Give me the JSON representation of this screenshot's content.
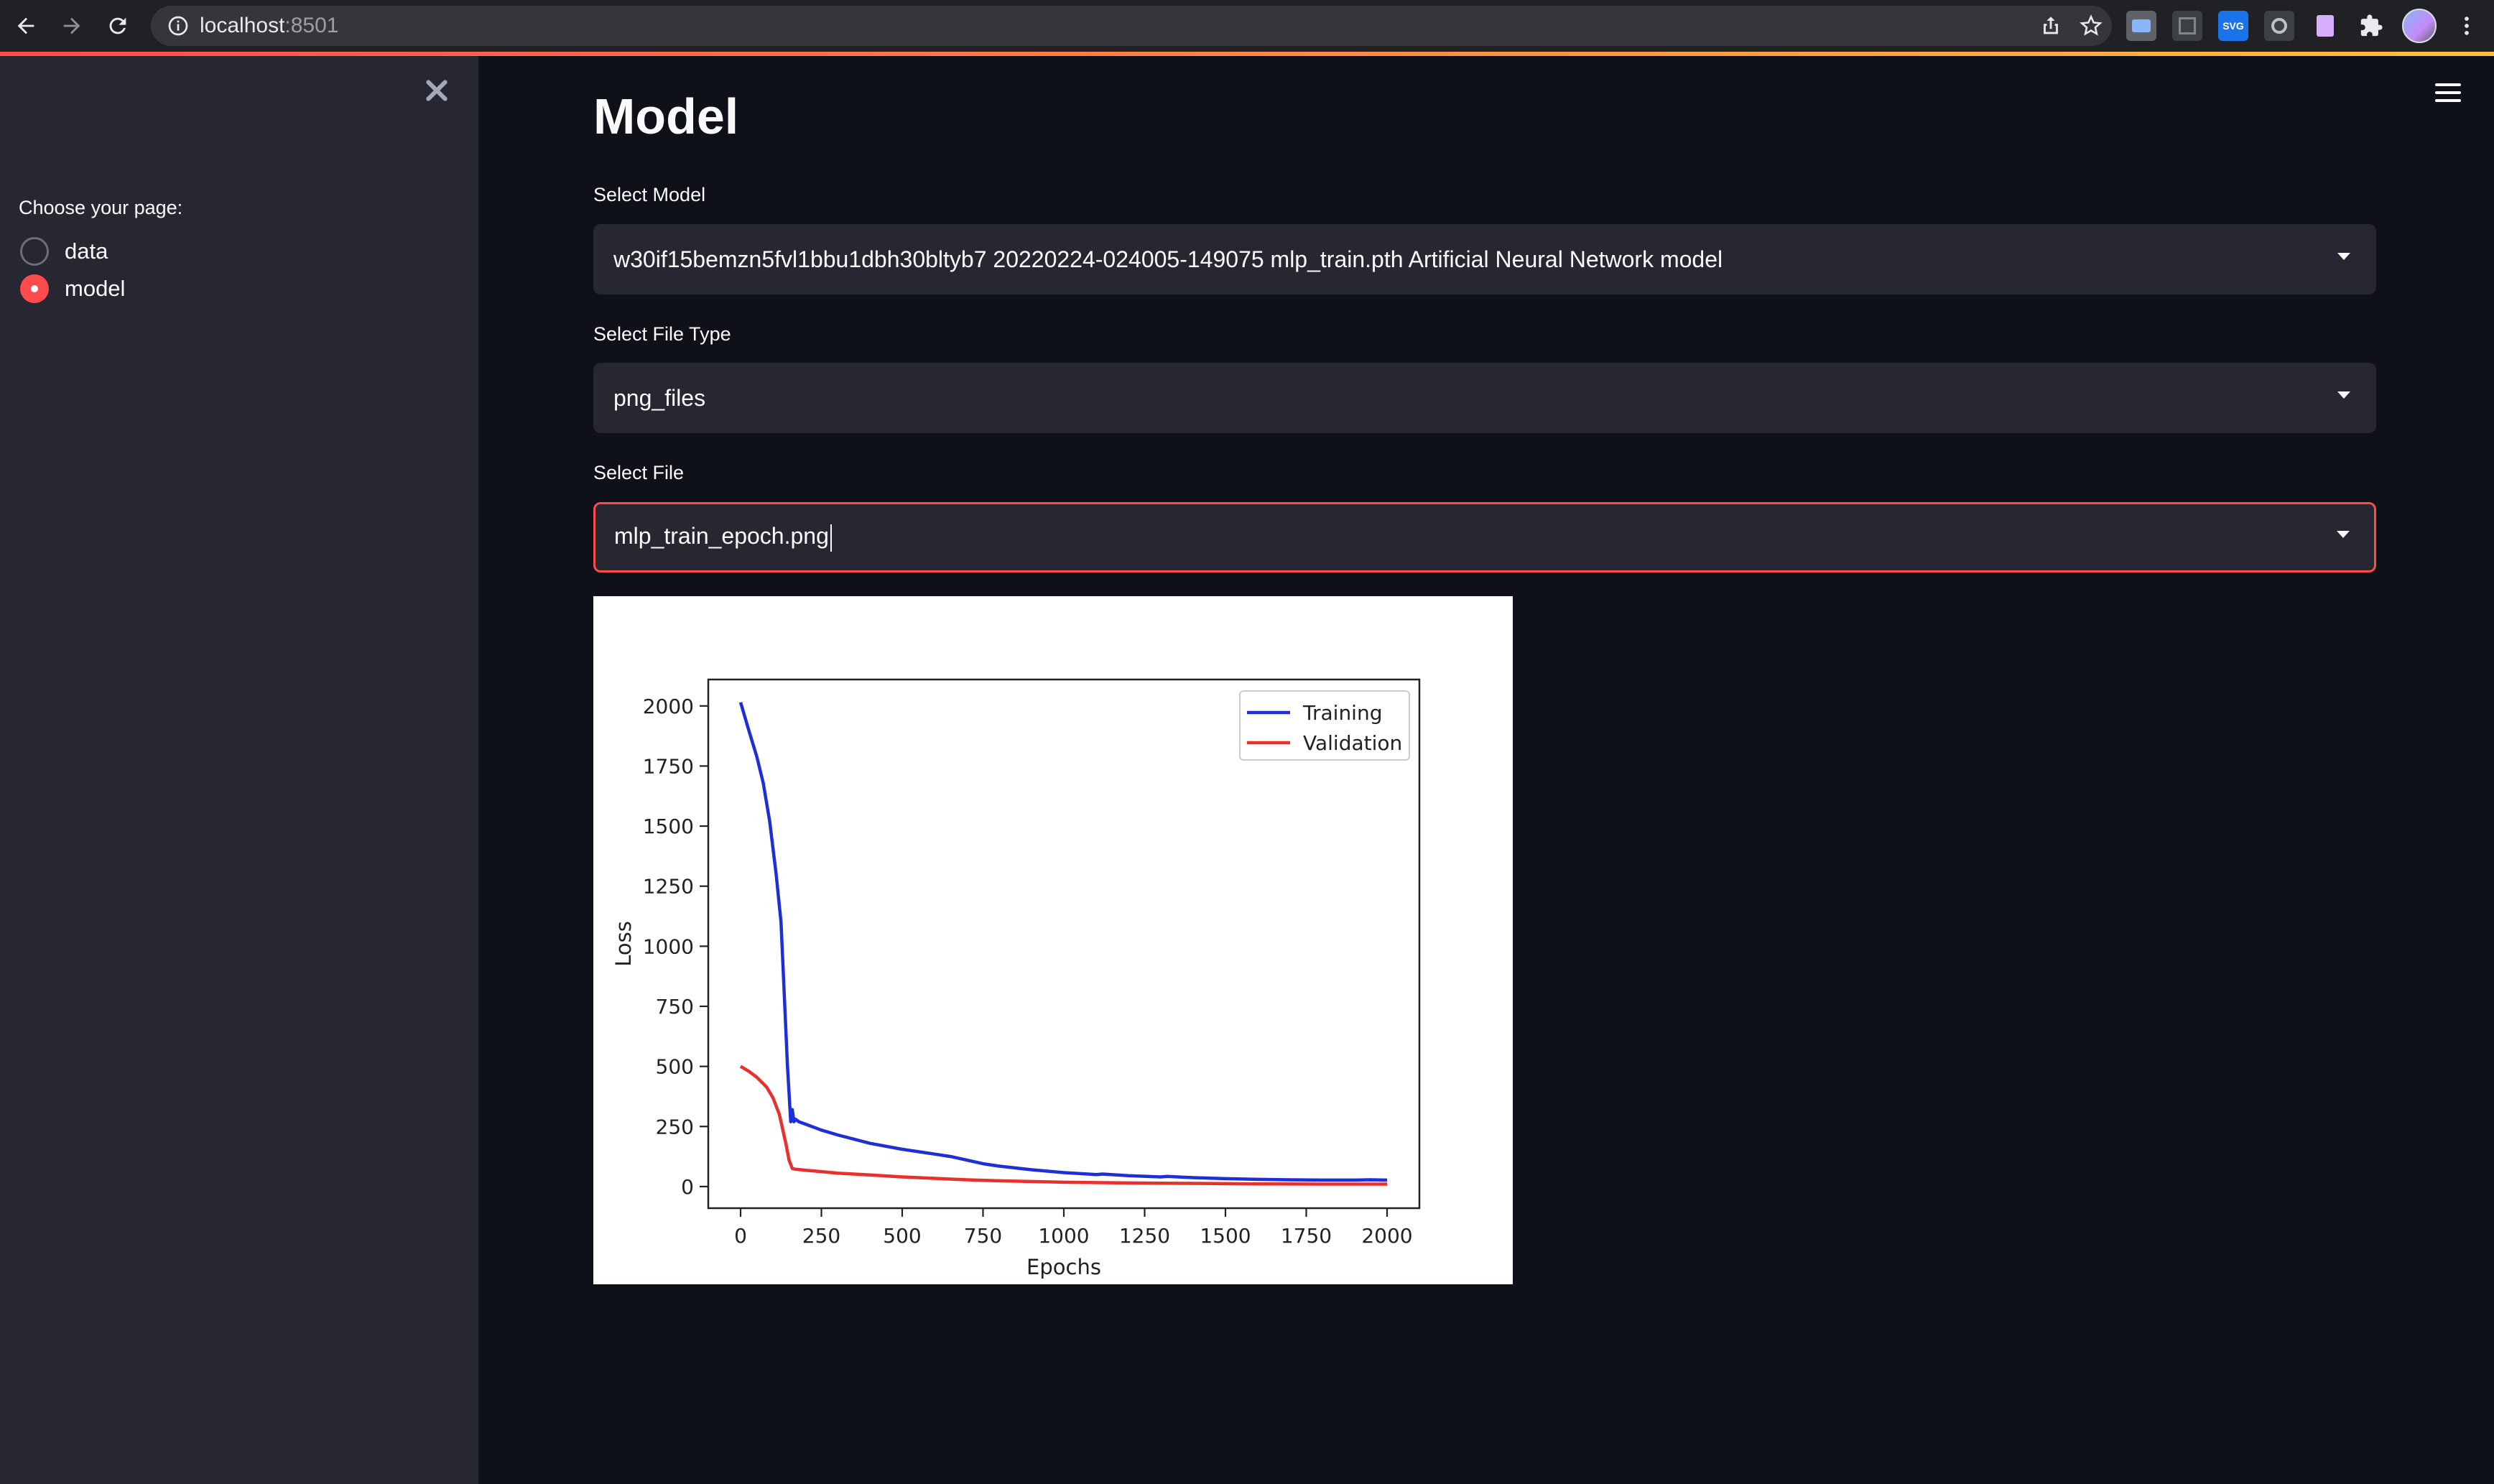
{
  "browser": {
    "url_host": "localhost",
    "url_port": ":8501",
    "extensions": [
      {
        "name": "screen-reader-extension-icon",
        "color": "#8ab4f8",
        "label": ""
      },
      {
        "name": "grid-extension-icon",
        "color": "#5f6368",
        "label": ""
      },
      {
        "name": "svg-extension-icon",
        "color": "#1a73e8",
        "label": "SVG"
      },
      {
        "name": "gear-extension-icon",
        "color": "#9aa0a6",
        "label": ""
      },
      {
        "name": "document-extension-icon",
        "color": "#c58af9",
        "label": ""
      },
      {
        "name": "puzzle-icon",
        "color": "#e8eaed",
        "label": ""
      }
    ]
  },
  "sidebar": {
    "label": "Choose your page:",
    "options": [
      {
        "label": "data",
        "checked": false
      },
      {
        "label": "model",
        "checked": true
      }
    ]
  },
  "main": {
    "title": "Model",
    "select_model": {
      "label": "Select Model",
      "value": "w30if15bemzn5fvl1bbu1dbh30bltyb7 20220224-024005-149075 mlp_train.pth Artificial Neural Network model"
    },
    "select_file_type": {
      "label": "Select File Type",
      "value": "png_files"
    },
    "select_file": {
      "label": "Select File",
      "value": "mlp_train_epoch.png"
    }
  },
  "colors": {
    "accent": "#ff4b4b",
    "sidebar_bg": "#262730",
    "app_bg": "#0e1117"
  },
  "chart_data": {
    "type": "line",
    "title": "",
    "xlabel": "Epochs",
    "ylabel": "Loss",
    "xlim": [
      -100,
      2100
    ],
    "ylim": [
      -90,
      2110
    ],
    "xticks": [
      0,
      250,
      500,
      750,
      1000,
      1250,
      1500,
      1750,
      2000
    ],
    "yticks": [
      0,
      250,
      500,
      750,
      1000,
      1250,
      1500,
      1750,
      2000
    ],
    "legend_position": "top-right",
    "grid": false,
    "series": [
      {
        "name": "Training",
        "color": "#1f2fd6",
        "x": [
          0,
          25,
          50,
          70,
          90,
          110,
          125,
          135,
          145,
          155,
          160,
          165,
          170,
          180,
          200,
          250,
          300,
          400,
          500,
          600,
          650,
          700,
          750,
          800,
          900,
          1000,
          1100,
          1120,
          1200,
          1300,
          1320,
          1400,
          1500,
          1600,
          1700,
          1800,
          1900,
          1950,
          2000
        ],
        "y": [
          2015,
          1900,
          1790,
          1680,
          1520,
          1300,
          1100,
          800,
          500,
          270,
          320,
          270,
          280,
          270,
          260,
          235,
          215,
          180,
          155,
          135,
          125,
          110,
          95,
          85,
          70,
          58,
          50,
          52,
          45,
          40,
          42,
          37,
          33,
          30,
          28,
          27,
          27,
          28,
          27
        ]
      },
      {
        "name": "Validation",
        "color": "#e8302c",
        "x": [
          0,
          25,
          50,
          80,
          100,
          120,
          140,
          150,
          160,
          170,
          200,
          250,
          300,
          400,
          500,
          600,
          700,
          800,
          900,
          1000,
          1200,
          1400,
          1600,
          1800,
          2000
        ],
        "y": [
          500,
          480,
          455,
          415,
          370,
          300,
          180,
          110,
          75,
          72,
          68,
          62,
          56,
          48,
          40,
          34,
          28,
          24,
          21,
          18,
          15,
          13,
          11,
          10,
          10
        ]
      }
    ]
  }
}
